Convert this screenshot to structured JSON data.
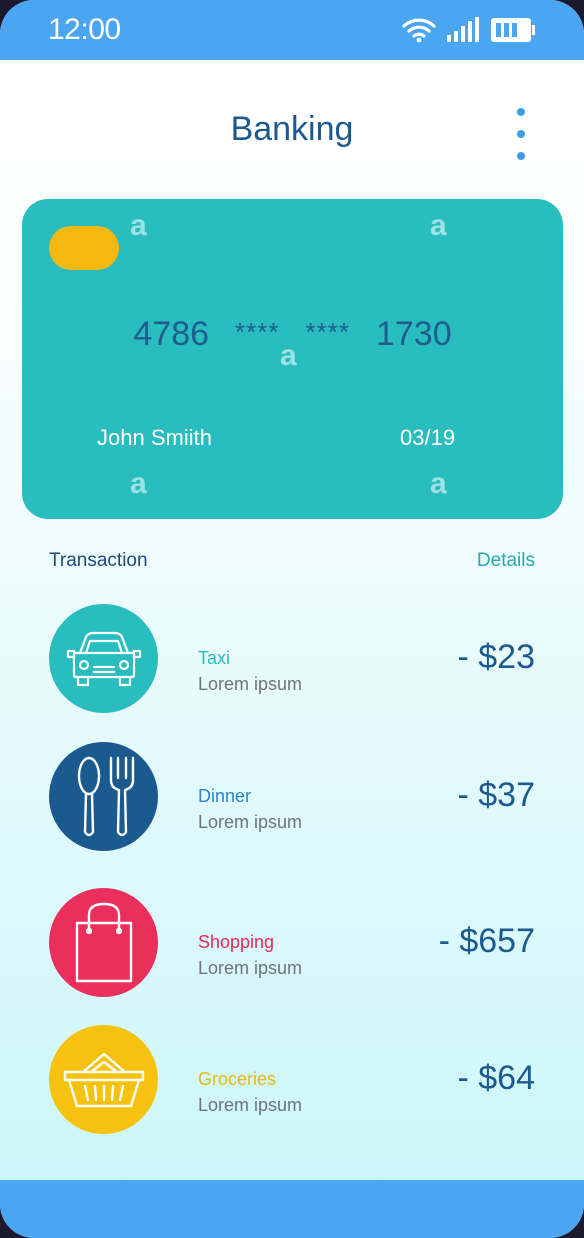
{
  "status_bar": {
    "time": "12:00"
  },
  "header": {
    "title": "Banking"
  },
  "card": {
    "number_groups": [
      "4786",
      "****",
      "****",
      "1730"
    ],
    "holder": "John Smiith",
    "expiry": "03/19",
    "colors": {
      "card": "#29bdbf",
      "chip": "#f5b80f"
    }
  },
  "transactions_section": {
    "title": "Transaction",
    "details_label": "Details"
  },
  "transactions": [
    {
      "name": "Taxi",
      "subtitle": "Lorem ipsum",
      "amount": "- $23",
      "icon": "car-icon",
      "color": "#29bdbf"
    },
    {
      "name": "Dinner",
      "subtitle": "Lorem ipsum",
      "amount": "- $37",
      "icon": "cutlery-icon",
      "color": "#1b5a8e"
    },
    {
      "name": "Shopping",
      "subtitle": "Lorem ipsum",
      "amount": "- $657",
      "icon": "shopping-bag-icon",
      "color": "#ea2f5d"
    },
    {
      "name": "Groceries",
      "subtitle": "Lorem ipsum",
      "amount": "- $64",
      "icon": "basket-icon",
      "color": "#f5c20f"
    }
  ],
  "theme": {
    "accent": "#4aa5f3",
    "title_text": "#1b5a8e"
  }
}
